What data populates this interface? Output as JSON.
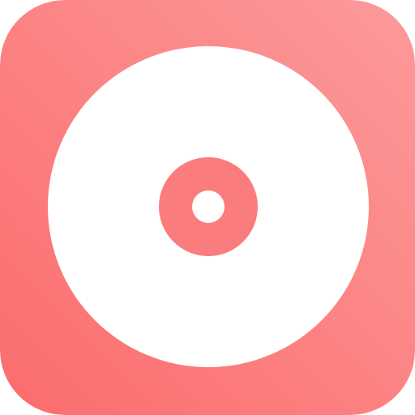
{
  "app_icon": {
    "name": "music-disc-app-icon",
    "icon": "disc-icon",
    "colors": {
      "gradient_start": "#fb6c6c",
      "gradient_end": "#fd9a9a",
      "disc": "#ffffff",
      "ring": "#fb7c7c",
      "hole": "#ffffff"
    }
  }
}
